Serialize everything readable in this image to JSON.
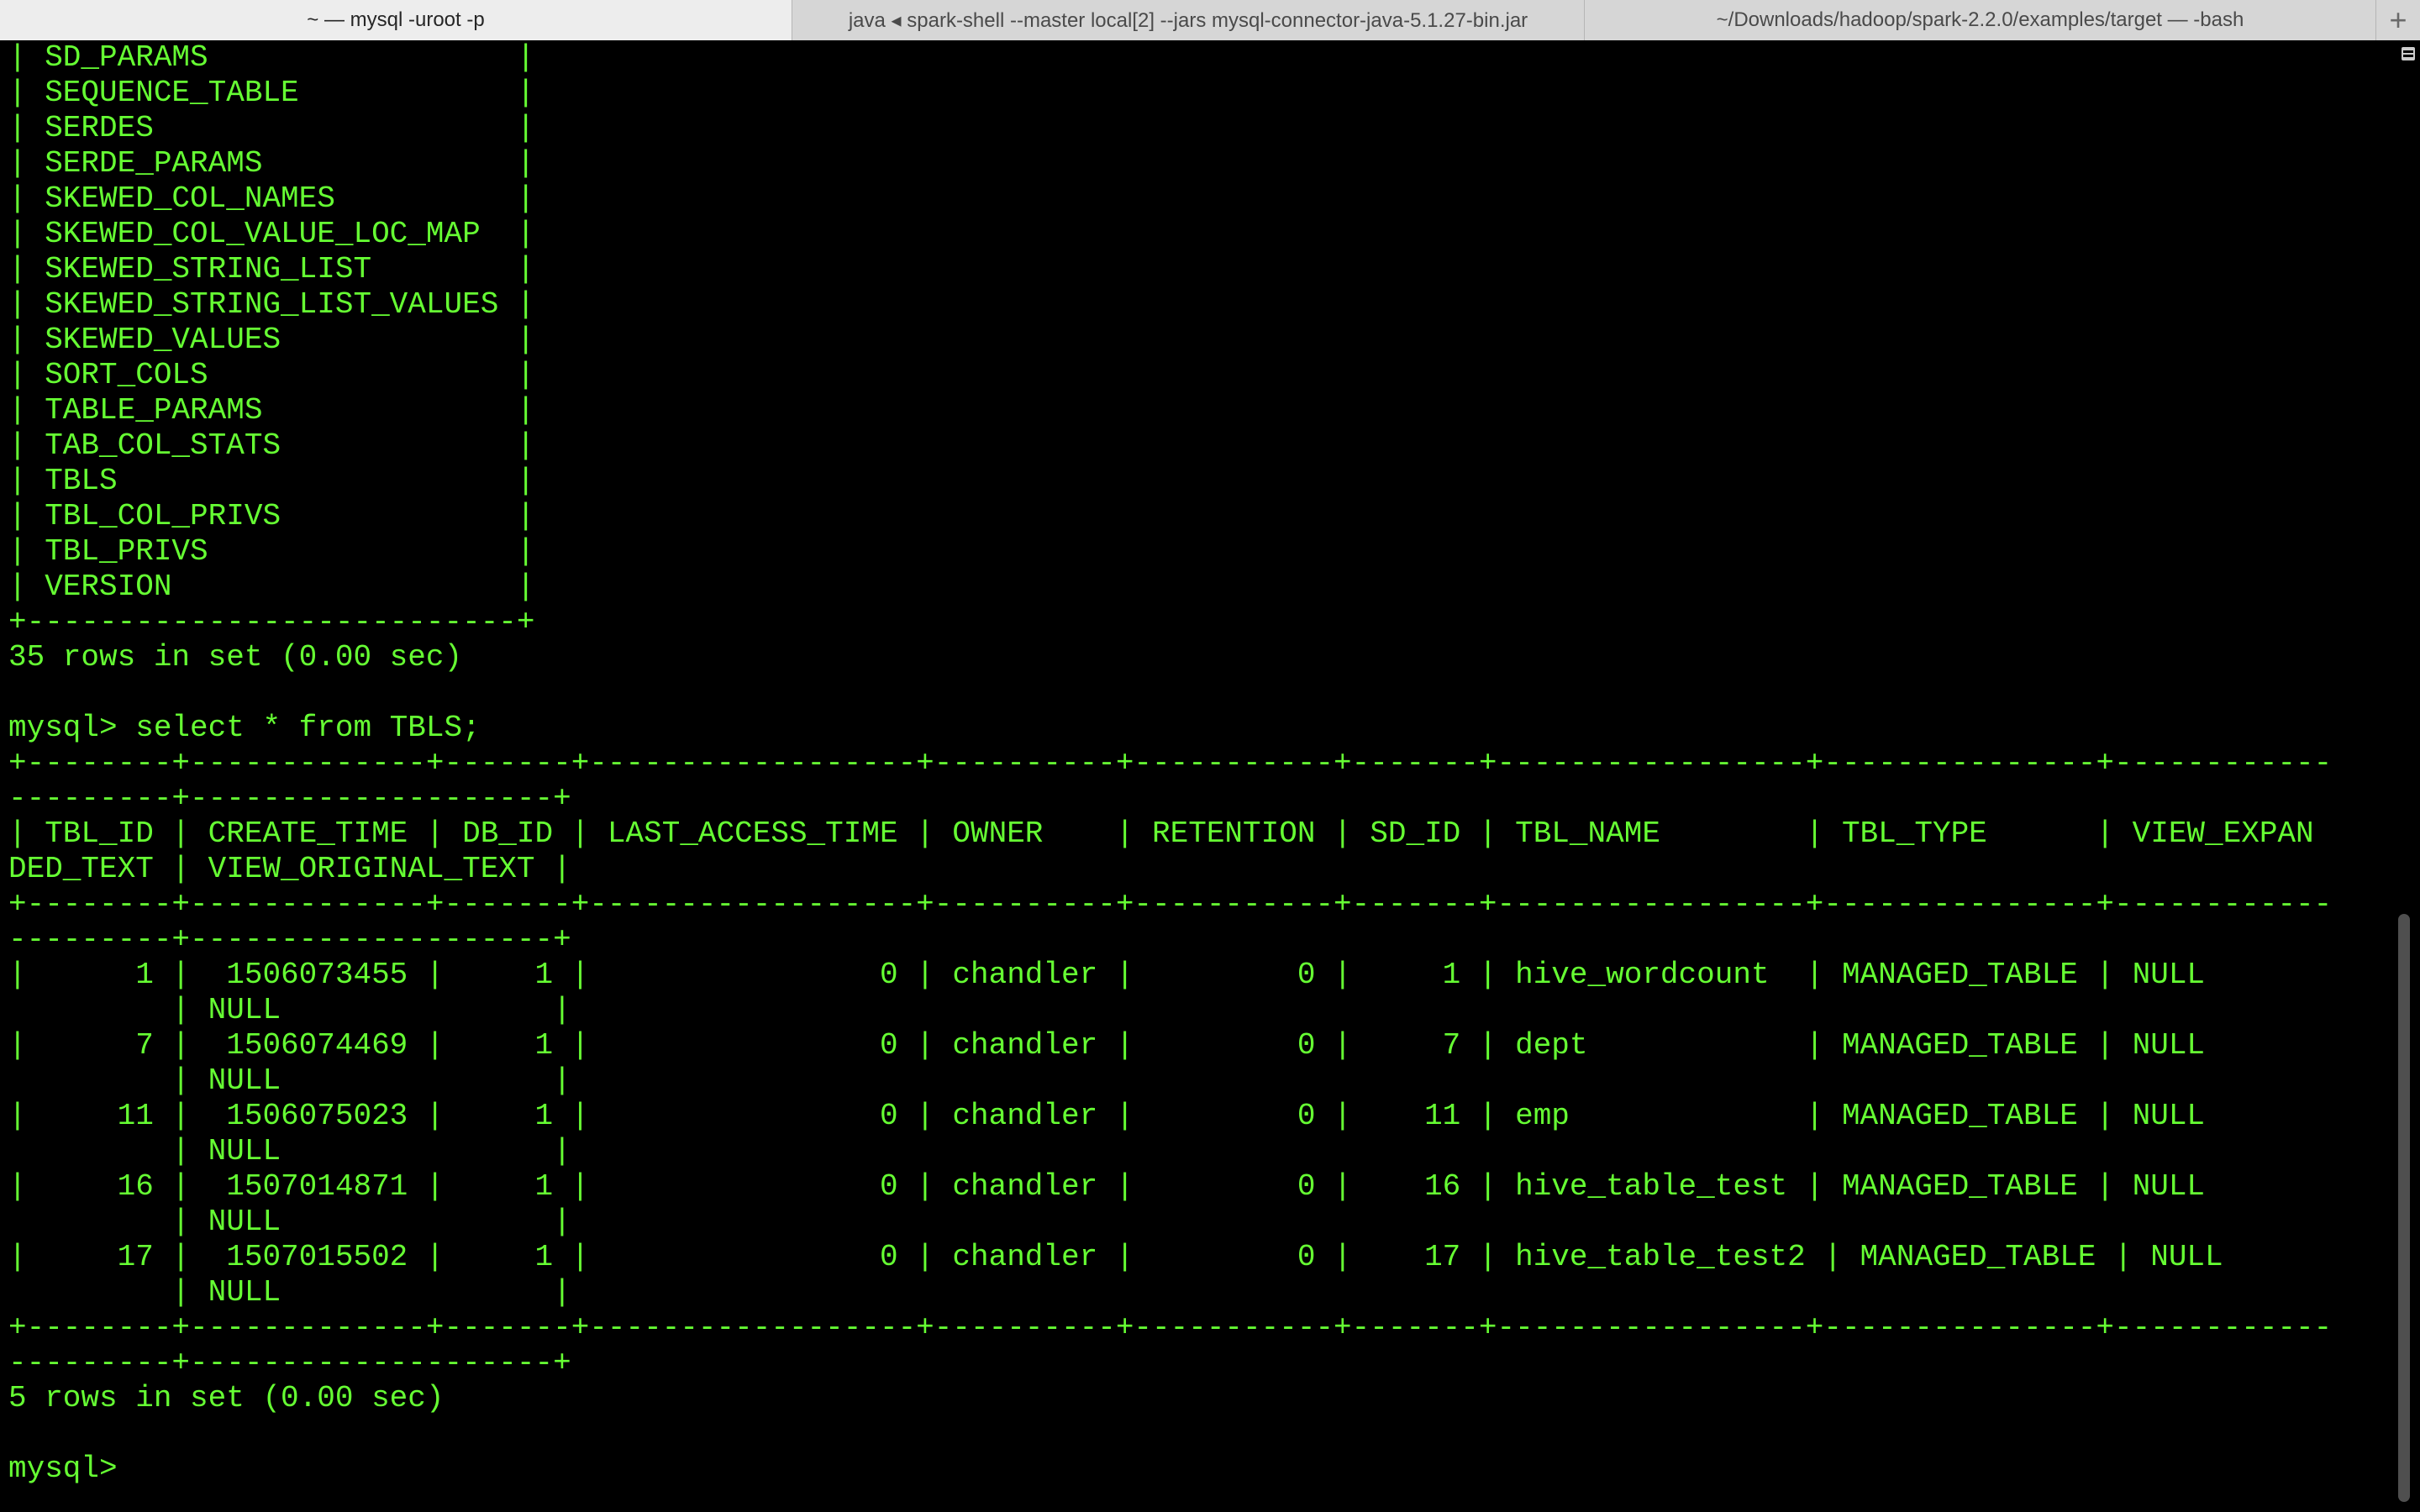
{
  "tabs": [
    {
      "label": "~ — mysql -uroot -p",
      "active": true
    },
    {
      "label": "java ◂ spark-shell --master local[2] --jars mysql-connector-java-5.1.27-bin.jar",
      "active": false
    },
    {
      "label": "~/Downloads/hadoop/spark-2.2.0/examples/target — -bash",
      "active": false
    }
  ],
  "new_tab_label": "+",
  "terminal": {
    "text_color": "#66ff33",
    "background": "#000000",
    "lines": [
      "| SD_PARAMS                 |",
      "| SEQUENCE_TABLE            |",
      "| SERDES                    |",
      "| SERDE_PARAMS              |",
      "| SKEWED_COL_NAMES          |",
      "| SKEWED_COL_VALUE_LOC_MAP  |",
      "| SKEWED_STRING_LIST        |",
      "| SKEWED_STRING_LIST_VALUES |",
      "| SKEWED_VALUES             |",
      "| SORT_COLS                 |",
      "| TABLE_PARAMS              |",
      "| TAB_COL_STATS             |",
      "| TBLS                      |",
      "| TBL_COL_PRIVS             |",
      "| TBL_PRIVS                 |",
      "| VERSION                   |",
      "+---------------------------+",
      "35 rows in set (0.00 sec)",
      "",
      "mysql> select * from TBLS;",
      "+--------+-------------+-------+------------------+----------+-----------+-------+-----------------+---------------+------------",
      "---------+--------------------+",
      "| TBL_ID | CREATE_TIME | DB_ID | LAST_ACCESS_TIME | OWNER    | RETENTION | SD_ID | TBL_NAME        | TBL_TYPE      | VIEW_EXPAN",
      "DED_TEXT | VIEW_ORIGINAL_TEXT |",
      "+--------+-------------+-------+------------------+----------+-----------+-------+-----------------+---------------+------------",
      "---------+--------------------+",
      "|      1 |  1506073455 |     1 |                0 | chandler |         0 |     1 | hive_wordcount  | MANAGED_TABLE | NULL",
      "         | NULL               |",
      "|      7 |  1506074469 |     1 |                0 | chandler |         0 |     7 | dept            | MANAGED_TABLE | NULL",
      "         | NULL               |",
      "|     11 |  1506075023 |     1 |                0 | chandler |         0 |    11 | emp             | MANAGED_TABLE | NULL",
      "         | NULL               |",
      "|     16 |  1507014871 |     1 |                0 | chandler |         0 |    16 | hive_table_test | MANAGED_TABLE | NULL",
      "         | NULL               |",
      "|     17 |  1507015502 |     1 |                0 | chandler |         0 |    17 | hive_table_test2 | MANAGED_TABLE | NULL",
      "         | NULL               |",
      "+--------+-------------+-------+------------------+----------+-----------+-------+-----------------+---------------+------------",
      "---------+--------------------+",
      "5 rows in set (0.00 sec)",
      "",
      "mysql> "
    ]
  },
  "icons": {
    "scrollbar_menu": "hamburger-menu-icon"
  }
}
